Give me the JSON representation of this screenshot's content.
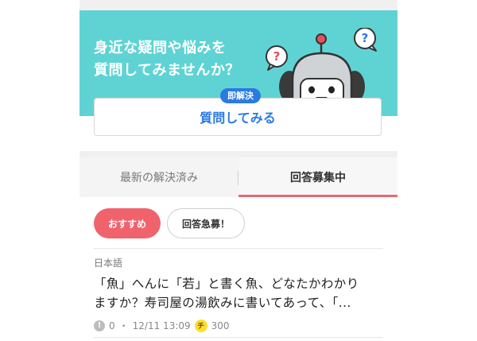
{
  "hero": {
    "line1": "身近な疑問や悩みを",
    "line2": "質問してみませんか？",
    "badge": "即解決",
    "ask_button": "質問してみる",
    "bubble_left": "?",
    "bubble_right": "?"
  },
  "tabs": [
    {
      "label": "最新の解決済み"
    },
    {
      "label": "回答募集中"
    }
  ],
  "filters": [
    {
      "label": "おすすめ"
    },
    {
      "label": "回答急募！"
    }
  ],
  "question": {
    "category": "日本語",
    "title_line1": "「魚」へんに「若」と書く魚、どなたかわかり",
    "title_line2": "ますか？寿司屋の湯飲みに書いてあって、「...",
    "answers_icon": "!",
    "answers": "0",
    "separator": "・",
    "date": "12/11 13:09",
    "coin_icon": "チ",
    "coins": "300"
  },
  "colors": {
    "hero_bg": "#5fd3d3",
    "accent_blue": "#2a7ae2",
    "accent_red": "#f0636d",
    "coin_yellow": "#ffdd2e"
  }
}
